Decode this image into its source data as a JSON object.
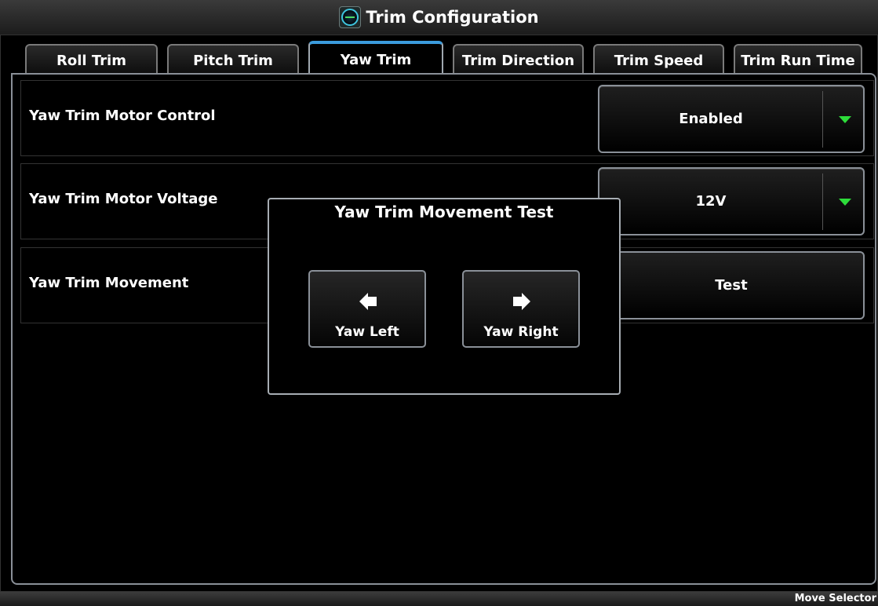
{
  "window": {
    "title": "Trim Configuration",
    "icon": "trim-app-icon"
  },
  "tabs": [
    {
      "label": "Roll Trim",
      "active": false
    },
    {
      "label": "Pitch Trim",
      "active": false
    },
    {
      "label": "Yaw Trim",
      "active": true
    },
    {
      "label": "Trim Direction",
      "active": false
    },
    {
      "label": "Trim Speed",
      "active": false
    },
    {
      "label": "Trim Run Time",
      "active": false
    }
  ],
  "rows": [
    {
      "label": "Yaw Trim Motor Control",
      "value": "Enabled",
      "control": "dropdown"
    },
    {
      "label": "Yaw Trim Motor Voltage",
      "value": "12V",
      "control": "dropdown"
    },
    {
      "label": "Yaw Trim Movement",
      "value": "Test",
      "control": "button"
    }
  ],
  "modal": {
    "title": "Yaw Trim Movement Test",
    "left_button": {
      "label": "Yaw Left",
      "icon": "arrow-left-icon"
    },
    "right_button": {
      "label": "Yaw Right",
      "icon": "arrow-right-icon"
    }
  },
  "status": {
    "hint": "Move Selector"
  },
  "colors": {
    "accent": "#3b9bdc",
    "dropdown_arrow": "#2ddc3a",
    "border": "#8a9098"
  }
}
